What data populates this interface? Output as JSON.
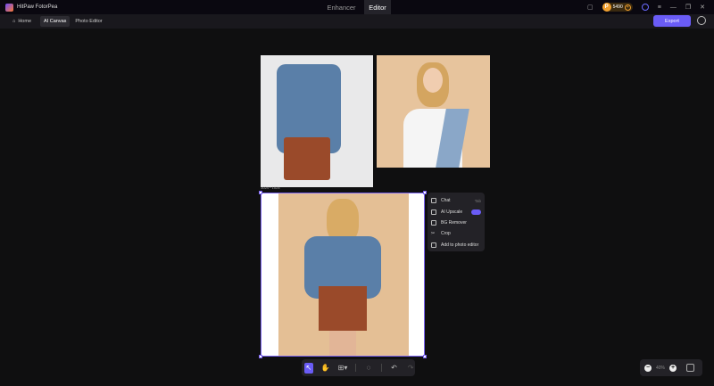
{
  "app": {
    "name": "HitPaw FotorPea"
  },
  "modes": [
    {
      "label": "Enhancer"
    },
    {
      "label": "Editor"
    }
  ],
  "credits": "5490",
  "nav": {
    "home": "Home",
    "ai_canvas": "AI Canvas",
    "photo_editor": "Photo Editor"
  },
  "export": "Export",
  "canvas": {
    "size_label": "1024 * 1024"
  },
  "context_menu": [
    {
      "label": "Chat",
      "shortcut": "Tab"
    },
    {
      "label": "AI Upscale",
      "badge": "credit"
    },
    {
      "label": "BG Remover"
    },
    {
      "label": "Crop"
    },
    {
      "label": "Add to photo editor"
    }
  ],
  "zoom": {
    "value": "40%"
  },
  "colors": {
    "accent": "#6a5cf6",
    "background": "#0f0f10"
  }
}
